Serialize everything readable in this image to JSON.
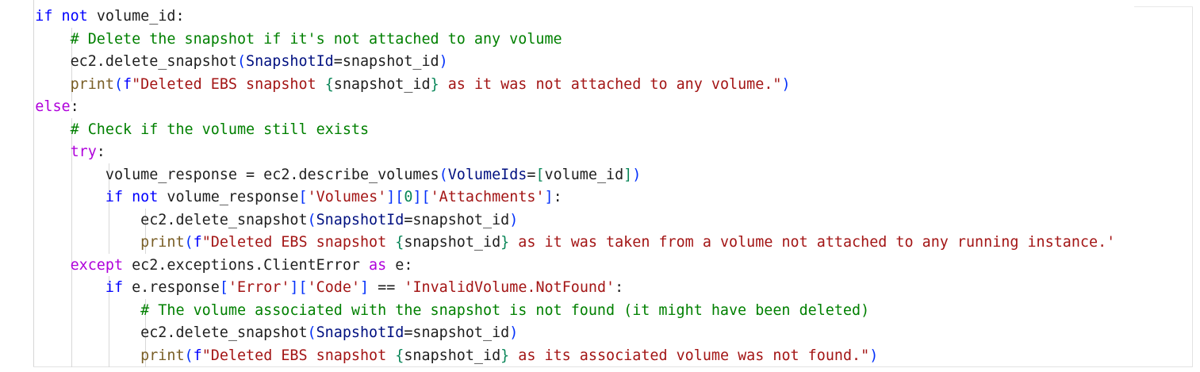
{
  "colors": {
    "keyword": "#0000ff",
    "control_keyword": "#af00db",
    "comment": "#008000",
    "string": "#a31515",
    "function": "#795e26",
    "parameter": "#001080",
    "number": "#098658",
    "bracket": "#0431fa",
    "plain": "#1f1f1f",
    "background": "#ffffff"
  },
  "code_lines": [
    {
      "indent": "    ",
      "tokens": [
        {
          "t": "if",
          "c": "kw"
        },
        {
          "t": " ",
          "c": "plain"
        },
        {
          "t": "not",
          "c": "kw"
        },
        {
          "t": " volume_id:",
          "c": "plain"
        }
      ]
    },
    {
      "indent": "        ",
      "tokens": [
        {
          "t": "# Delete the snapshot if it's not attached to any volume",
          "c": "cmt"
        }
      ]
    },
    {
      "indent": "        ",
      "tokens": [
        {
          "t": "ec2.delete_snapshot",
          "c": "plain"
        },
        {
          "t": "(",
          "c": "paren"
        },
        {
          "t": "SnapshotId",
          "c": "param"
        },
        {
          "t": "=snapshot_id",
          "c": "plain"
        },
        {
          "t": ")",
          "c": "paren"
        }
      ]
    },
    {
      "indent": "        ",
      "tokens": [
        {
          "t": "print",
          "c": "fn"
        },
        {
          "t": "(",
          "c": "paren"
        },
        {
          "t": "f",
          "c": "kw"
        },
        {
          "t": "\"Deleted EBS snapshot ",
          "c": "str"
        },
        {
          "t": "{",
          "c": "brace"
        },
        {
          "t": "snapshot_id",
          "c": "plain"
        },
        {
          "t": "}",
          "c": "brace"
        },
        {
          "t": " as it was not attached to any volume.\"",
          "c": "str"
        },
        {
          "t": ")",
          "c": "paren"
        }
      ]
    },
    {
      "indent": "    ",
      "tokens": [
        {
          "t": "else",
          "c": "kw2"
        },
        {
          "t": ":",
          "c": "plain"
        }
      ]
    },
    {
      "indent": "        ",
      "tokens": [
        {
          "t": "# Check if the volume still exists",
          "c": "cmt"
        }
      ]
    },
    {
      "indent": "        ",
      "tokens": [
        {
          "t": "try",
          "c": "kw2"
        },
        {
          "t": ":",
          "c": "plain"
        }
      ]
    },
    {
      "indent": "            ",
      "tokens": [
        {
          "t": "volume_response = ec2.describe_volumes",
          "c": "plain"
        },
        {
          "t": "(",
          "c": "paren"
        },
        {
          "t": "VolumeIds",
          "c": "param"
        },
        {
          "t": "=",
          "c": "plain"
        },
        {
          "t": "[",
          "c": "brace"
        },
        {
          "t": "volume_id",
          "c": "plain"
        },
        {
          "t": "]",
          "c": "brace"
        },
        {
          "t": ")",
          "c": "paren"
        }
      ]
    },
    {
      "indent": "            ",
      "tokens": [
        {
          "t": "if",
          "c": "kw"
        },
        {
          "t": " ",
          "c": "plain"
        },
        {
          "t": "not",
          "c": "kw"
        },
        {
          "t": " volume_response",
          "c": "plain"
        },
        {
          "t": "[",
          "c": "paren"
        },
        {
          "t": "'Volumes'",
          "c": "str"
        },
        {
          "t": "][",
          "c": "paren"
        },
        {
          "t": "0",
          "c": "num"
        },
        {
          "t": "][",
          "c": "paren"
        },
        {
          "t": "'Attachments'",
          "c": "str"
        },
        {
          "t": "]",
          "c": "paren"
        },
        {
          "t": ":",
          "c": "plain"
        }
      ]
    },
    {
      "indent": "                ",
      "tokens": [
        {
          "t": "ec2.delete_snapshot",
          "c": "plain"
        },
        {
          "t": "(",
          "c": "paren"
        },
        {
          "t": "SnapshotId",
          "c": "param"
        },
        {
          "t": "=snapshot_id",
          "c": "plain"
        },
        {
          "t": ")",
          "c": "paren"
        }
      ]
    },
    {
      "indent": "                ",
      "tokens": [
        {
          "t": "print",
          "c": "fn"
        },
        {
          "t": "(",
          "c": "paren"
        },
        {
          "t": "f",
          "c": "kw"
        },
        {
          "t": "\"Deleted EBS snapshot ",
          "c": "str"
        },
        {
          "t": "{",
          "c": "brace"
        },
        {
          "t": "snapshot_id",
          "c": "plain"
        },
        {
          "t": "}",
          "c": "brace"
        },
        {
          "t": " as it was taken from a volume not attached to any running instance.'",
          "c": "str"
        }
      ]
    },
    {
      "indent": "        ",
      "tokens": [
        {
          "t": "except",
          "c": "kw2"
        },
        {
          "t": " ec2.exceptions.ClientError ",
          "c": "plain"
        },
        {
          "t": "as",
          "c": "kw2"
        },
        {
          "t": " e:",
          "c": "plain"
        }
      ]
    },
    {
      "indent": "            ",
      "tokens": [
        {
          "t": "if",
          "c": "kw"
        },
        {
          "t": " e.response",
          "c": "plain"
        },
        {
          "t": "[",
          "c": "paren"
        },
        {
          "t": "'Error'",
          "c": "str"
        },
        {
          "t": "][",
          "c": "paren"
        },
        {
          "t": "'Code'",
          "c": "str"
        },
        {
          "t": "]",
          "c": "paren"
        },
        {
          "t": " == ",
          "c": "plain"
        },
        {
          "t": "'InvalidVolume.NotFound'",
          "c": "str"
        },
        {
          "t": ":",
          "c": "plain"
        }
      ]
    },
    {
      "indent": "                ",
      "tokens": [
        {
          "t": "# The volume associated with the snapshot is not found (it might have been deleted)",
          "c": "cmt"
        }
      ]
    },
    {
      "indent": "                ",
      "tokens": [
        {
          "t": "ec2.delete_snapshot",
          "c": "plain"
        },
        {
          "t": "(",
          "c": "paren"
        },
        {
          "t": "SnapshotId",
          "c": "param"
        },
        {
          "t": "=snapshot_id",
          "c": "plain"
        },
        {
          "t": ")",
          "c": "paren"
        }
      ]
    },
    {
      "indent": "                ",
      "tokens": [
        {
          "t": "print",
          "c": "fn"
        },
        {
          "t": "(",
          "c": "paren"
        },
        {
          "t": "f",
          "c": "kw"
        },
        {
          "t": "\"Deleted EBS snapshot ",
          "c": "str"
        },
        {
          "t": "{",
          "c": "brace"
        },
        {
          "t": "snapshot_id",
          "c": "plain"
        },
        {
          "t": "}",
          "c": "brace"
        },
        {
          "t": " as its associated volume was not found.\"",
          "c": "str"
        },
        {
          "t": ")",
          "c": "paren"
        }
      ]
    }
  ]
}
